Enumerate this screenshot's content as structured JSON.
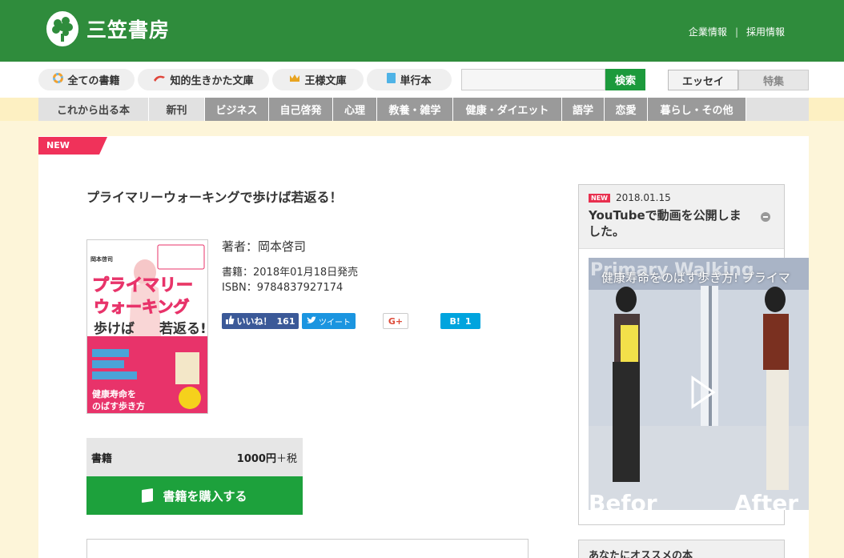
{
  "header": {
    "logo_text": "三笠書房",
    "links": [
      "企業情報",
      "採用情報"
    ],
    "brand_color": "#2f8c3c"
  },
  "category_nav": {
    "items": [
      {
        "label": "全ての書籍",
        "icon": "rainbow-circle-icon"
      },
      {
        "label": "知的生きかた文庫",
        "icon": "red-swoosh-icon"
      },
      {
        "label": "王様文庫",
        "icon": "crown-icon"
      },
      {
        "label": "単行本",
        "icon": "book-icon"
      }
    ],
    "search_placeholder": "",
    "search_button": "検索",
    "tabs": [
      "エッセイ",
      "特集"
    ]
  },
  "genre_nav": {
    "items": [
      "これから出る本",
      "新刊",
      "ビジネス",
      "自己啓発",
      "心理",
      "教養・雑学",
      "健康・ダイエット",
      "語学",
      "恋愛",
      "暮らし・その他"
    ]
  },
  "book": {
    "badge": "NEW",
    "title": "プライマリーウォーキングで歩けば若返る！",
    "author": "著者：岡本啓司",
    "release": "書籍：2018年01月18日発売",
    "isbn": "ISBN：9784837927174",
    "cover": {
      "author_small": "岡本啓司",
      "headline_1": "プライマリー",
      "headline_2": "ウォーキング",
      "headline_3": "歩けば",
      "headline_4": "若返る!",
      "tagline_1": "健康寿命を",
      "tagline_2": "のばす歩き方"
    },
    "share": {
      "like_label": "いいね！",
      "like_count": "161",
      "tweet_label": "ツイート",
      "gplus_label": "G+",
      "hatena_label": "B!",
      "hatena_count": "1"
    },
    "price_label": "書籍",
    "price": "1000円",
    "tax": "＋税",
    "buy_label": "書籍を購入する"
  },
  "sidebar": {
    "news_badge": "NEW",
    "news_date": "2018.01.15",
    "news_title": "YouTubeで動画を公開しました。",
    "video_title": "健康寿命をのばす歩き方! プライマ",
    "video_overlay_top": "Primary Walking",
    "video_overlay_left": "Befor",
    "video_overlay_right": "After",
    "recommend_title": "あなたにオススメの本"
  }
}
